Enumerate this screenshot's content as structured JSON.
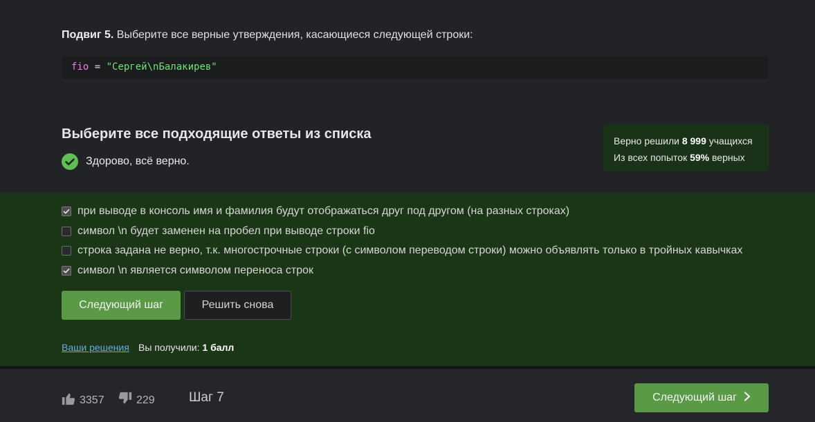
{
  "task": {
    "prefix": "Подвиг 5.",
    "text": " Выберите все верные утверждения, касающиеся следующей строки:"
  },
  "code": {
    "var": "fio",
    "op": " = ",
    "str": "\"Сергей\\nБалакирев\""
  },
  "quiz": {
    "title": "Выберите все подходящие ответы из списка",
    "result": "Здорово, всё верно.",
    "stats": {
      "line1_prefix": "Верно решили ",
      "solved_count": "8 999",
      "line1_suffix": " учащихся",
      "line2_prefix": "Из всех попыток ",
      "percent": "59%",
      "line2_suffix": " верных"
    },
    "options": [
      {
        "label": "при выводе в консоль имя и фамилия будут отображаться друг под другом (на разных строках)",
        "checked": true
      },
      {
        "label": "символ \\n будет заменен на пробел при выводе строки fio",
        "checked": false
      },
      {
        "label": "строка задана не верно, т.к. многострочные строки (с символом переводом строки) можно объявлять только в тройных кавычках",
        "checked": false
      },
      {
        "label": "символ \\n является символом переноса строк",
        "checked": true
      }
    ],
    "next_button": "Следующий шаг",
    "retry_button": "Решить снова",
    "solutions_link": "Ваши решения",
    "score_prefix": "Вы получили: ",
    "score_value": "1 балл"
  },
  "footer": {
    "likes": "3357",
    "dislikes": "229",
    "step": "Шаг 7",
    "next_button": "Следующий шаг"
  },
  "colors": {
    "accent_green": "#5a9a46",
    "answer_bg": "#1b3616",
    "check_green": "#5fbf55",
    "link_blue": "#6ea6e6"
  }
}
